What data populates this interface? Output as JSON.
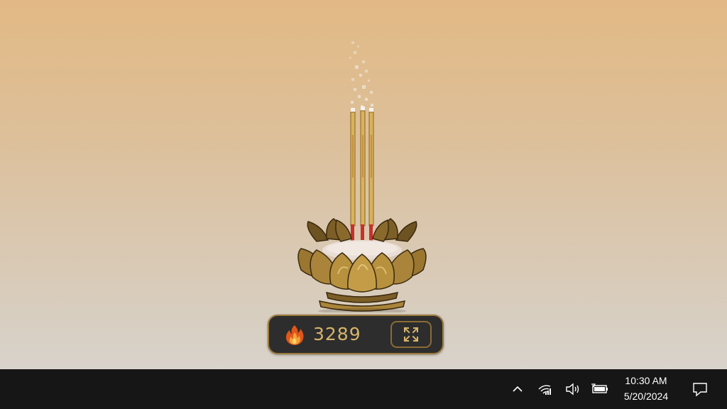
{
  "widget": {
    "count": "3289",
    "icons": {
      "counter": "flame-icon",
      "expand": "expand-icon"
    },
    "colors": {
      "panel_bg": "#2d2d2d",
      "panel_border": "#9a7a3c",
      "count_text": "#d7b46a",
      "incense_stick": "#d9b35a",
      "incense_base": "#c8302a",
      "burner_bronze": "#8a6a2c"
    }
  },
  "taskbar": {
    "tray_icons": [
      "chevron-up-icon",
      "wifi-icon",
      "volume-icon",
      "battery-icon"
    ],
    "time": "10:30 AM",
    "date": "5/20/2024",
    "notification_icon": "notification-icon"
  },
  "desktop": {
    "background_colors": [
      "#e2b985",
      "#d8d3cb"
    ]
  }
}
